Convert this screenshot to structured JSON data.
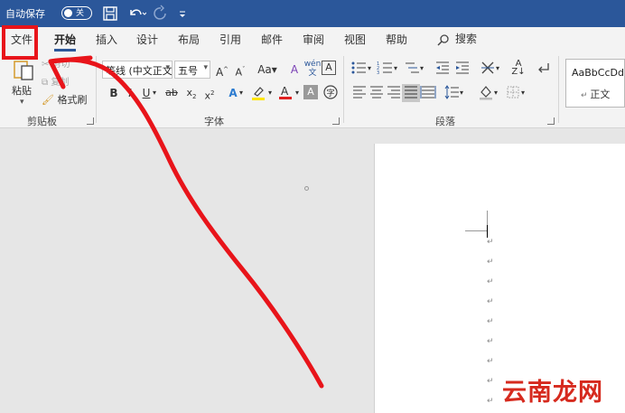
{
  "titlebar": {
    "autosave_label": "自动保存",
    "autosave_state": "关"
  },
  "tabs": [
    "文件",
    "开始",
    "插入",
    "设计",
    "布局",
    "引用",
    "邮件",
    "审阅",
    "视图",
    "帮助"
  ],
  "active_tab": "开始",
  "search_label": "搜索",
  "clipboard": {
    "paste_label": "粘贴",
    "cut_label": "剪切",
    "copy_label": "复制",
    "format_painter_label": "格式刷",
    "group_label": "剪贴板"
  },
  "font": {
    "font_name": "等线 (中文正文)",
    "font_size": "五号",
    "group_label": "字体"
  },
  "paragraph": {
    "group_label": "段落"
  },
  "styles": {
    "sample_text": "AaBbCcDd",
    "style_name": "正文"
  },
  "document": {
    "paragraph_mark": "↵"
  },
  "watermark": "云南龙网",
  "colors": {
    "titlebar": "#2b579a",
    "annotation": "#e8141a"
  }
}
